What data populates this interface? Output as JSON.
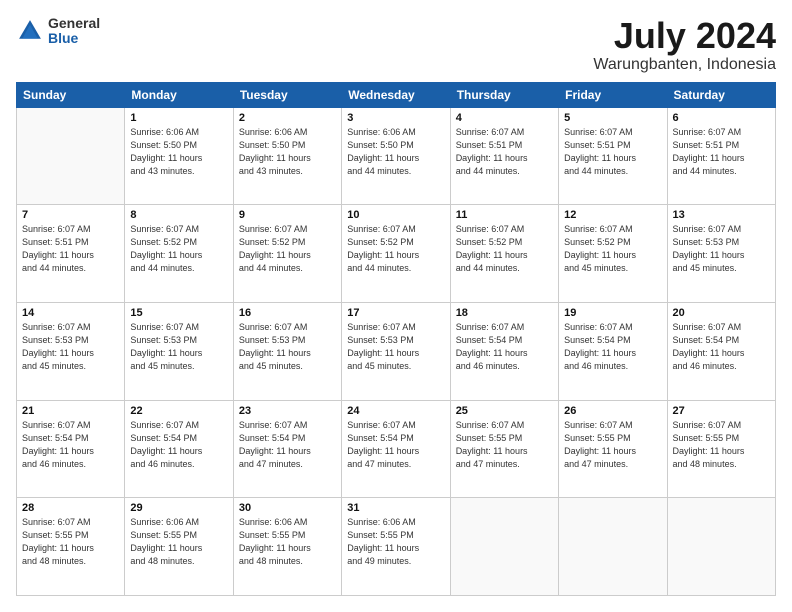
{
  "logo": {
    "general": "General",
    "blue": "Blue"
  },
  "header": {
    "month_year": "July 2024",
    "location": "Warungbanten, Indonesia"
  },
  "days_of_week": [
    "Sunday",
    "Monday",
    "Tuesday",
    "Wednesday",
    "Thursday",
    "Friday",
    "Saturday"
  ],
  "weeks": [
    [
      {
        "day": "",
        "info": ""
      },
      {
        "day": "1",
        "info": "Sunrise: 6:06 AM\nSunset: 5:50 PM\nDaylight: 11 hours\nand 43 minutes."
      },
      {
        "day": "2",
        "info": "Sunrise: 6:06 AM\nSunset: 5:50 PM\nDaylight: 11 hours\nand 43 minutes."
      },
      {
        "day": "3",
        "info": "Sunrise: 6:06 AM\nSunset: 5:50 PM\nDaylight: 11 hours\nand 44 minutes."
      },
      {
        "day": "4",
        "info": "Sunrise: 6:07 AM\nSunset: 5:51 PM\nDaylight: 11 hours\nand 44 minutes."
      },
      {
        "day": "5",
        "info": "Sunrise: 6:07 AM\nSunset: 5:51 PM\nDaylight: 11 hours\nand 44 minutes."
      },
      {
        "day": "6",
        "info": "Sunrise: 6:07 AM\nSunset: 5:51 PM\nDaylight: 11 hours\nand 44 minutes."
      }
    ],
    [
      {
        "day": "7",
        "info": "Sunrise: 6:07 AM\nSunset: 5:51 PM\nDaylight: 11 hours\nand 44 minutes."
      },
      {
        "day": "8",
        "info": "Sunrise: 6:07 AM\nSunset: 5:52 PM\nDaylight: 11 hours\nand 44 minutes."
      },
      {
        "day": "9",
        "info": "Sunrise: 6:07 AM\nSunset: 5:52 PM\nDaylight: 11 hours\nand 44 minutes."
      },
      {
        "day": "10",
        "info": "Sunrise: 6:07 AM\nSunset: 5:52 PM\nDaylight: 11 hours\nand 44 minutes."
      },
      {
        "day": "11",
        "info": "Sunrise: 6:07 AM\nSunset: 5:52 PM\nDaylight: 11 hours\nand 44 minutes."
      },
      {
        "day": "12",
        "info": "Sunrise: 6:07 AM\nSunset: 5:52 PM\nDaylight: 11 hours\nand 45 minutes."
      },
      {
        "day": "13",
        "info": "Sunrise: 6:07 AM\nSunset: 5:53 PM\nDaylight: 11 hours\nand 45 minutes."
      }
    ],
    [
      {
        "day": "14",
        "info": "Sunrise: 6:07 AM\nSunset: 5:53 PM\nDaylight: 11 hours\nand 45 minutes."
      },
      {
        "day": "15",
        "info": "Sunrise: 6:07 AM\nSunset: 5:53 PM\nDaylight: 11 hours\nand 45 minutes."
      },
      {
        "day": "16",
        "info": "Sunrise: 6:07 AM\nSunset: 5:53 PM\nDaylight: 11 hours\nand 45 minutes."
      },
      {
        "day": "17",
        "info": "Sunrise: 6:07 AM\nSunset: 5:53 PM\nDaylight: 11 hours\nand 45 minutes."
      },
      {
        "day": "18",
        "info": "Sunrise: 6:07 AM\nSunset: 5:54 PM\nDaylight: 11 hours\nand 46 minutes."
      },
      {
        "day": "19",
        "info": "Sunrise: 6:07 AM\nSunset: 5:54 PM\nDaylight: 11 hours\nand 46 minutes."
      },
      {
        "day": "20",
        "info": "Sunrise: 6:07 AM\nSunset: 5:54 PM\nDaylight: 11 hours\nand 46 minutes."
      }
    ],
    [
      {
        "day": "21",
        "info": "Sunrise: 6:07 AM\nSunset: 5:54 PM\nDaylight: 11 hours\nand 46 minutes."
      },
      {
        "day": "22",
        "info": "Sunrise: 6:07 AM\nSunset: 5:54 PM\nDaylight: 11 hours\nand 46 minutes."
      },
      {
        "day": "23",
        "info": "Sunrise: 6:07 AM\nSunset: 5:54 PM\nDaylight: 11 hours\nand 47 minutes."
      },
      {
        "day": "24",
        "info": "Sunrise: 6:07 AM\nSunset: 5:54 PM\nDaylight: 11 hours\nand 47 minutes."
      },
      {
        "day": "25",
        "info": "Sunrise: 6:07 AM\nSunset: 5:55 PM\nDaylight: 11 hours\nand 47 minutes."
      },
      {
        "day": "26",
        "info": "Sunrise: 6:07 AM\nSunset: 5:55 PM\nDaylight: 11 hours\nand 47 minutes."
      },
      {
        "day": "27",
        "info": "Sunrise: 6:07 AM\nSunset: 5:55 PM\nDaylight: 11 hours\nand 48 minutes."
      }
    ],
    [
      {
        "day": "28",
        "info": "Sunrise: 6:07 AM\nSunset: 5:55 PM\nDaylight: 11 hours\nand 48 minutes."
      },
      {
        "day": "29",
        "info": "Sunrise: 6:06 AM\nSunset: 5:55 PM\nDaylight: 11 hours\nand 48 minutes."
      },
      {
        "day": "30",
        "info": "Sunrise: 6:06 AM\nSunset: 5:55 PM\nDaylight: 11 hours\nand 48 minutes."
      },
      {
        "day": "31",
        "info": "Sunrise: 6:06 AM\nSunset: 5:55 PM\nDaylight: 11 hours\nand 49 minutes."
      },
      {
        "day": "",
        "info": ""
      },
      {
        "day": "",
        "info": ""
      },
      {
        "day": "",
        "info": ""
      }
    ]
  ]
}
